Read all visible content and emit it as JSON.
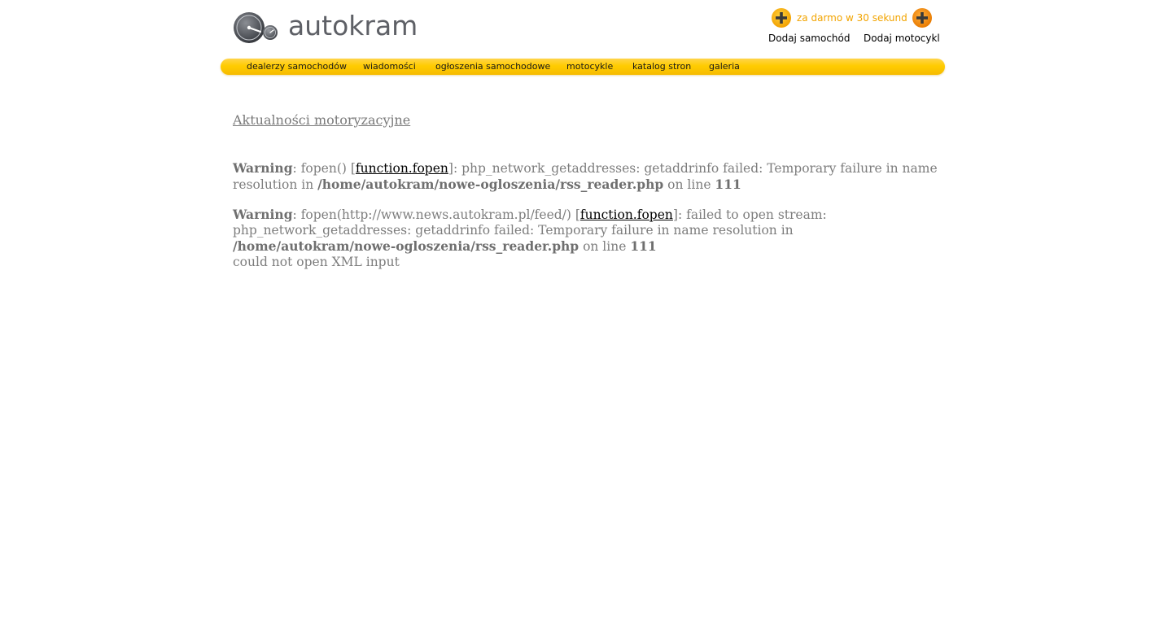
{
  "header": {
    "logo_text": "autokram",
    "promo_text": "za darmo w 30 sekund",
    "add_car": "Dodaj samochód",
    "add_motorcycle": "Dodaj motocykl"
  },
  "nav": {
    "items": [
      {
        "label": "dealerzy samochodów"
      },
      {
        "label": "wiadomości"
      },
      {
        "label": "ogłoszenia samochodowe"
      },
      {
        "label": "motocykle"
      },
      {
        "label": "katalog stron"
      },
      {
        "label": "galeria"
      }
    ]
  },
  "main": {
    "title": "Aktualności motoryzacyjne",
    "warnings": [
      {
        "label": "Warning",
        "pre": ": fopen() [",
        "link": "function.fopen",
        "post": "]: php_network_getaddresses: getaddrinfo failed: Temporary failure in name resolution in ",
        "path": "/home/autokram/nowe-ogloszenia/rss_reader.php",
        "on_line": " on line ",
        "line": "111"
      },
      {
        "label": "Warning",
        "pre": ": fopen(http://www.news.autokram.pl/feed/) [",
        "link": "function.fopen",
        "post": "]: failed to open stream: php_network_getaddresses: getaddrinfo failed: Temporary failure in name resolution in ",
        "path": "/home/autokram/nowe-ogloszenia/rss_reader.php",
        "on_line": " on line ",
        "line": "111"
      }
    ],
    "error_tail": "could not open XML input"
  },
  "colors": {
    "nav_bar": "#ffcc00",
    "promo_text": "#f2a400",
    "body_text": "#7d7d7d"
  },
  "icons": {
    "logo": "speedometer-logo-icon",
    "add": "plus-circle-icon"
  }
}
